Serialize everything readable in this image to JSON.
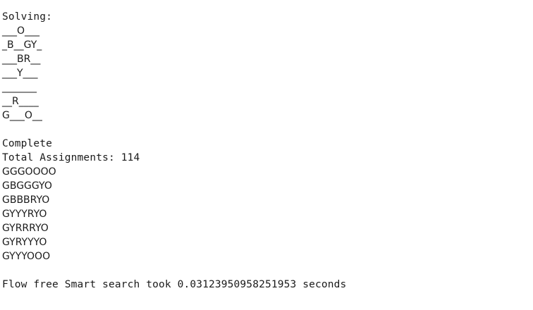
{
  "console": {
    "solving_label": "Solving:",
    "puzzle_rows": [
      "___O___",
      "_B__GY_",
      "___BR__",
      "___Y___",
      "_______",
      "__R____",
      "G___O__"
    ],
    "complete_label": "Complete",
    "total_assignments": "Total Assignments: 114",
    "solution_rows": [
      "GGGOOOO",
      "GBGGGYO",
      "GBBBRYO",
      "GYYYRYO",
      "GYRRRYO",
      "GYRYYYO",
      "GYYYOOO"
    ],
    "timing": "Flow free Smart search took 0.03123950958251953 seconds"
  }
}
